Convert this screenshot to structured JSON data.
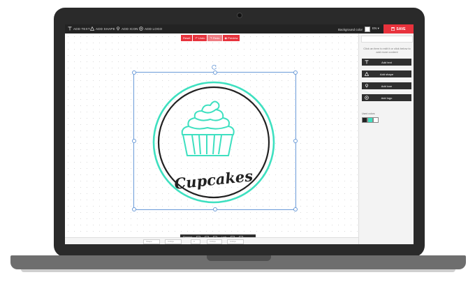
{
  "toolbar": {
    "add_text": "ADD TEXT",
    "add_shape": "ADD SHAPE",
    "add_icon": "ADD ICON",
    "add_logo": "ADD LOGO",
    "background_color_label": "Background color",
    "language": "EN",
    "save_label": "SAVE"
  },
  "canvas_toolbar": {
    "reset": "Reset",
    "undo": "Undo",
    "redo": "Redo",
    "preview": "Preview"
  },
  "logo": {
    "text": "Cupcakes",
    "ring_color": "#3ee0c0",
    "line_color": "#222222"
  },
  "bottom_tools": {
    "label": "Element",
    "arrange_label": "Lock"
  },
  "statusbar": {
    "fields": [
      "Shape",
      "0.00px",
      "0",
      "0.00px",
      "0.00px"
    ]
  },
  "panel": {
    "hint": "Click an item to edit it or click below to add more content",
    "buttons": [
      "Add text",
      "Add shape",
      "Add icon",
      "Add logo"
    ],
    "colors_label": "Used colors",
    "colors": [
      "#222222",
      "#3ee0c0",
      "#ffffff"
    ]
  }
}
